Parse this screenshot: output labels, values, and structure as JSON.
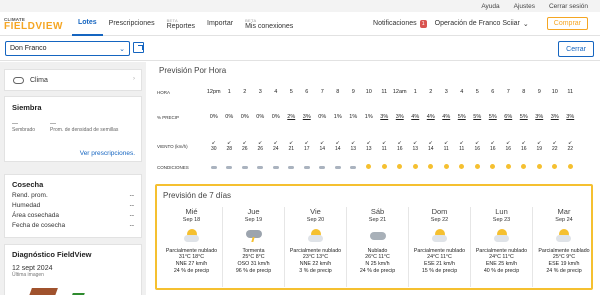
{
  "utility": {
    "help": "Ayuda",
    "settings": "Ajustes",
    "logout": "Cerrar sesión"
  },
  "logo": {
    "top": "CLIMATE",
    "main": "FIELDVIEW"
  },
  "nav": {
    "items": [
      {
        "label": "Lotes",
        "beta": ""
      },
      {
        "label": "Prescripciones",
        "beta": ""
      },
      {
        "label": "Reportes",
        "beta": "BETA"
      },
      {
        "label": "Importar",
        "beta": ""
      },
      {
        "label": "Mis conexiones",
        "beta": "BETA"
      }
    ],
    "notifications_label": "Notificaciones",
    "notifications_count": "1",
    "operation": "Operación de Franco Sciiar",
    "buy": "Comprar"
  },
  "toolbar": {
    "farm": "Don Franco",
    "close": "Cerrar"
  },
  "sidebar": {
    "clima": "Clima",
    "siembra": {
      "title": "Siembra",
      "sown_value": "---",
      "sown_label": "Sembrado",
      "density_value": "---",
      "density_label": "Prom. de densidad de semillas",
      "link": "Ver prescripciones."
    },
    "cosecha": {
      "title": "Cosecha",
      "rows": [
        {
          "label": "Rend. prom.",
          "value": "--"
        },
        {
          "label": "Humedad",
          "value": "--"
        },
        {
          "label": "Área cosechada",
          "value": "--"
        },
        {
          "label": "Fecha de cosecha",
          "value": "--"
        }
      ]
    },
    "diagnostico": {
      "title": "Diagnóstico FieldView",
      "date": "12 sept 2024",
      "sub": "Última imagen"
    }
  },
  "hourly": {
    "title": "Previsión Por Hora",
    "hora_label": "HORA",
    "hours": [
      "12pm",
      "1",
      "2",
      "3",
      "4",
      "5",
      "6",
      "7",
      "8",
      "9",
      "10",
      "11",
      "12am",
      "1",
      "2",
      "3",
      "4",
      "5",
      "6",
      "7",
      "8",
      "9",
      "10",
      "11"
    ],
    "precip_label": "% PRECIP",
    "precip": [
      "0%",
      "0%",
      "0%",
      "0%",
      "0%",
      "2%",
      "3%",
      "0%",
      "1%",
      "1%",
      "1%",
      "3%",
      "3%",
      "4%",
      "4%",
      "4%",
      "5%",
      "5%",
      "5%",
      "6%",
      "5%",
      "3%",
      "3%",
      "3%"
    ],
    "wind_label": "VIENTO (km/h)",
    "wind": [
      "30",
      "28",
      "26",
      "26",
      "24",
      "21",
      "17",
      "14",
      "14",
      "13",
      "13",
      "11",
      "16",
      "13",
      "14",
      "11",
      "11",
      "16",
      "16",
      "16",
      "16",
      "19",
      "22",
      "22"
    ],
    "cond_label": "CONDICIONES",
    "conditions": [
      "moon",
      "moon",
      "moon",
      "moon",
      "moon",
      "moon",
      "moon",
      "moon",
      "moon",
      "moon",
      "sun",
      "sun",
      "sun",
      "sun",
      "sun",
      "sun",
      "sun",
      "sun",
      "sun",
      "sun",
      "sun",
      "sun",
      "sun",
      "sun"
    ]
  },
  "forecast": {
    "title": "Previsión de 7 días",
    "days": [
      {
        "name": "Mié",
        "date": "Sep 18",
        "icon": "sun-cloud",
        "condition": "Parcialmente nublado",
        "temp": "31°C 18°C",
        "wind": "NNE 27 km/h",
        "precip": "24 % de precip"
      },
      {
        "name": "Jue",
        "date": "Sep 19",
        "icon": "storm",
        "condition": "Tormenta",
        "temp": "25°C 8°C",
        "wind": "OSO 31 km/h",
        "precip": "96 % de precip"
      },
      {
        "name": "Vie",
        "date": "Sep 20",
        "icon": "sun-cloud",
        "condition": "Parcialmente nublado",
        "temp": "23°C 13°C",
        "wind": "NNE 22 km/h",
        "precip": "3 % de precip"
      },
      {
        "name": "Sáb",
        "date": "Sep 21",
        "icon": "cloudy",
        "condition": "Nublado",
        "temp": "26°C 11°C",
        "wind": "N 25 km/h",
        "precip": "24 % de precip"
      },
      {
        "name": "Dom",
        "date": "Sep 22",
        "icon": "sun-cloud",
        "condition": "Parcialmente nublado",
        "temp": "24°C 11°C",
        "wind": "ESE 21 km/h",
        "precip": "15 % de precip"
      },
      {
        "name": "Lun",
        "date": "Sep 23",
        "icon": "sun-cloud",
        "condition": "Parcialmente nublado",
        "temp": "24°C 11°C",
        "wind": "ENE 25 km/h",
        "precip": "40 % de precip"
      },
      {
        "name": "Mar",
        "date": "Sep 24",
        "icon": "sun-cloud",
        "condition": "Parcialmente nublado",
        "temp": "25°C 9°C",
        "wind": "ESE 19 km/h",
        "precip": "24 % de precip"
      }
    ]
  },
  "colors": {
    "accent": "#1565c0",
    "brand": "#f5a623",
    "highlight": "#f5c030"
  }
}
